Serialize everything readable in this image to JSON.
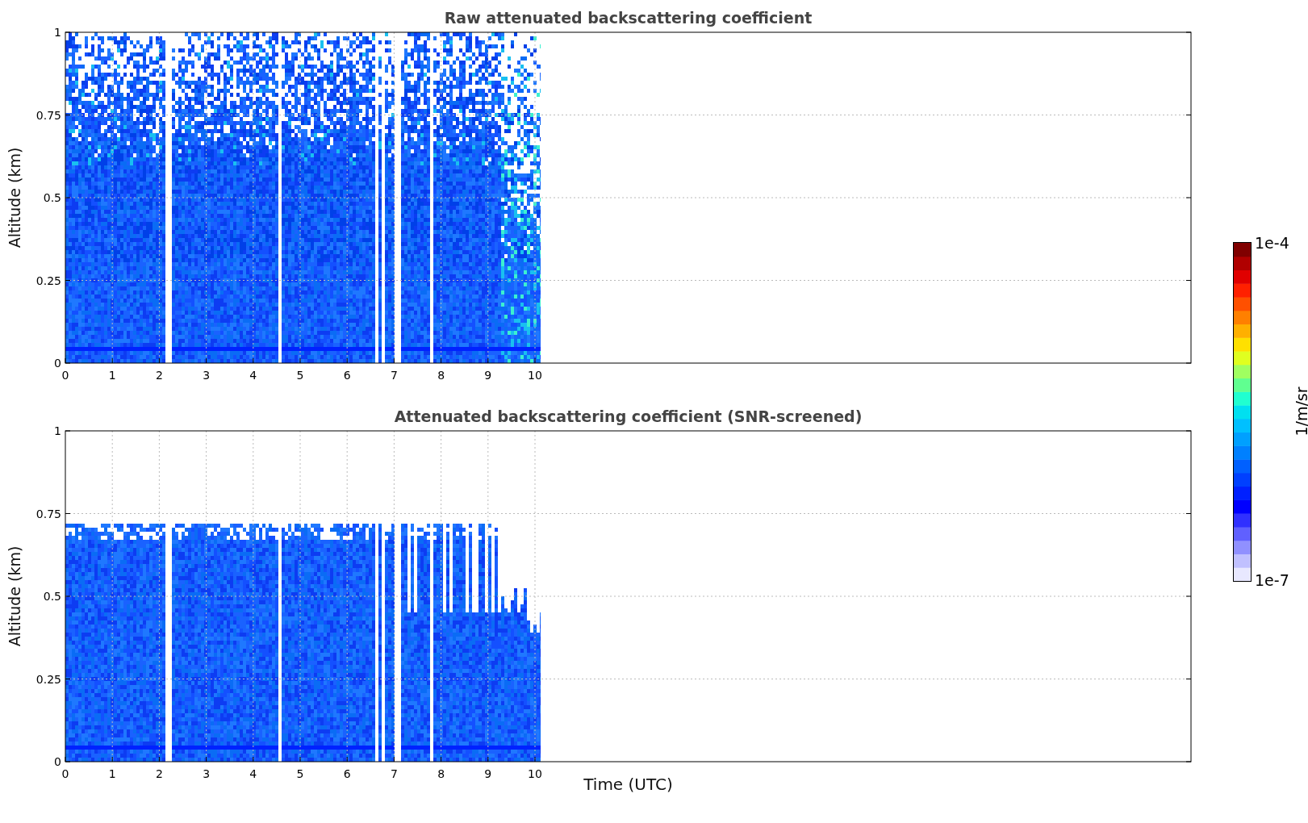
{
  "panels": [
    {
      "kind": "raw",
      "title": "Raw attenuated backscattering coefficient",
      "ylabel": "Altitude (km)",
      "yticks": [
        "1",
        "0.75",
        "0.5",
        "0.25",
        "0"
      ],
      "xticks": [
        "0",
        "1",
        "2",
        "3",
        "4",
        "5",
        "6",
        "7",
        "8",
        "9",
        "10"
      ]
    },
    {
      "kind": "screened",
      "title": "Attenuated backscattering coefficient (SNR-screened)",
      "ylabel": "Altitude (km)",
      "yticks": [
        "1",
        "0.75",
        "0.5",
        "0.25",
        "0"
      ],
      "xticks": [
        "0",
        "1",
        "2",
        "3",
        "4",
        "5",
        "6",
        "7",
        "8",
        "9",
        "10"
      ]
    }
  ],
  "xlabel": "Time (UTC)",
  "colorbar": {
    "max": "1e-4",
    "min": "1e-7",
    "label": "1/m/sr"
  }
}
